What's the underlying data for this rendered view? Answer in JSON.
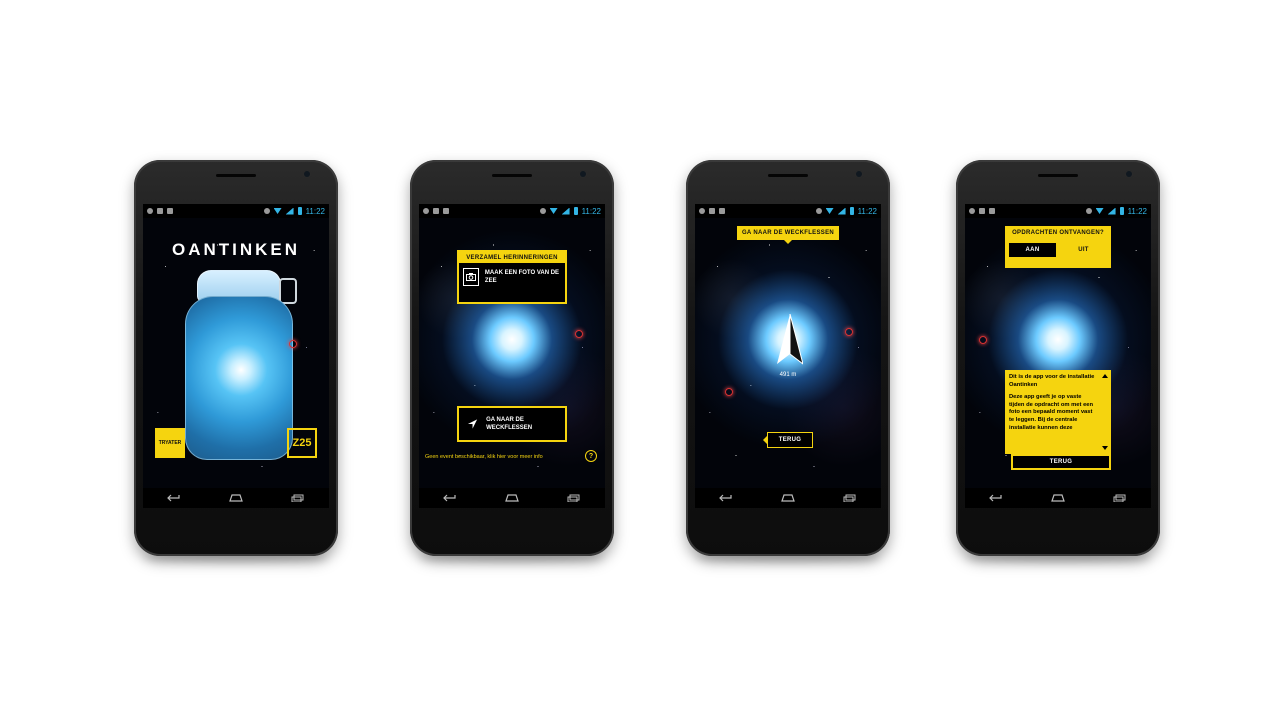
{
  "status_bar": {
    "time": "11:22"
  },
  "screen1": {
    "title": "OANTINKEN",
    "tryater_logo": "TRYATER",
    "z25_logo": "Z25"
  },
  "screen2": {
    "card_heading": "VERZAMEL HERINNERINGEN",
    "photo_action": "MAAK EEN FOTO VAN DE ZEE",
    "go_action": "GA NAAR DE WECKFLESSEN",
    "footer": "Geen event beschikbaar, klik hier voor meer info",
    "help": "?"
  },
  "screen3": {
    "heading": "GA NAAR DE WECKFLESSEN",
    "distance": "491 m",
    "back": "TERUG"
  },
  "screen4": {
    "question": "OPDRACHTEN ONTVANGEN?",
    "toggle_on": "AAN",
    "toggle_off": "UIT",
    "info_para1": "Dit is de app voor de installatie Oantinken",
    "info_para2": "Deze app geeft je op vaste tijden de opdracht om met een foto een bepaald moment vast te leggen. Bij de centrale installatie kunnen deze",
    "back": "TERUG"
  },
  "colors": {
    "accent": "#f5d40f",
    "status_blue": "#33b5e5",
    "background": "#ffffff"
  },
  "icons": [
    "settings-icon",
    "image-icon",
    "mail-icon",
    "camera-icon",
    "navigation-arrow-icon",
    "help-icon",
    "back-icon",
    "home-icon",
    "recents-icon"
  ]
}
